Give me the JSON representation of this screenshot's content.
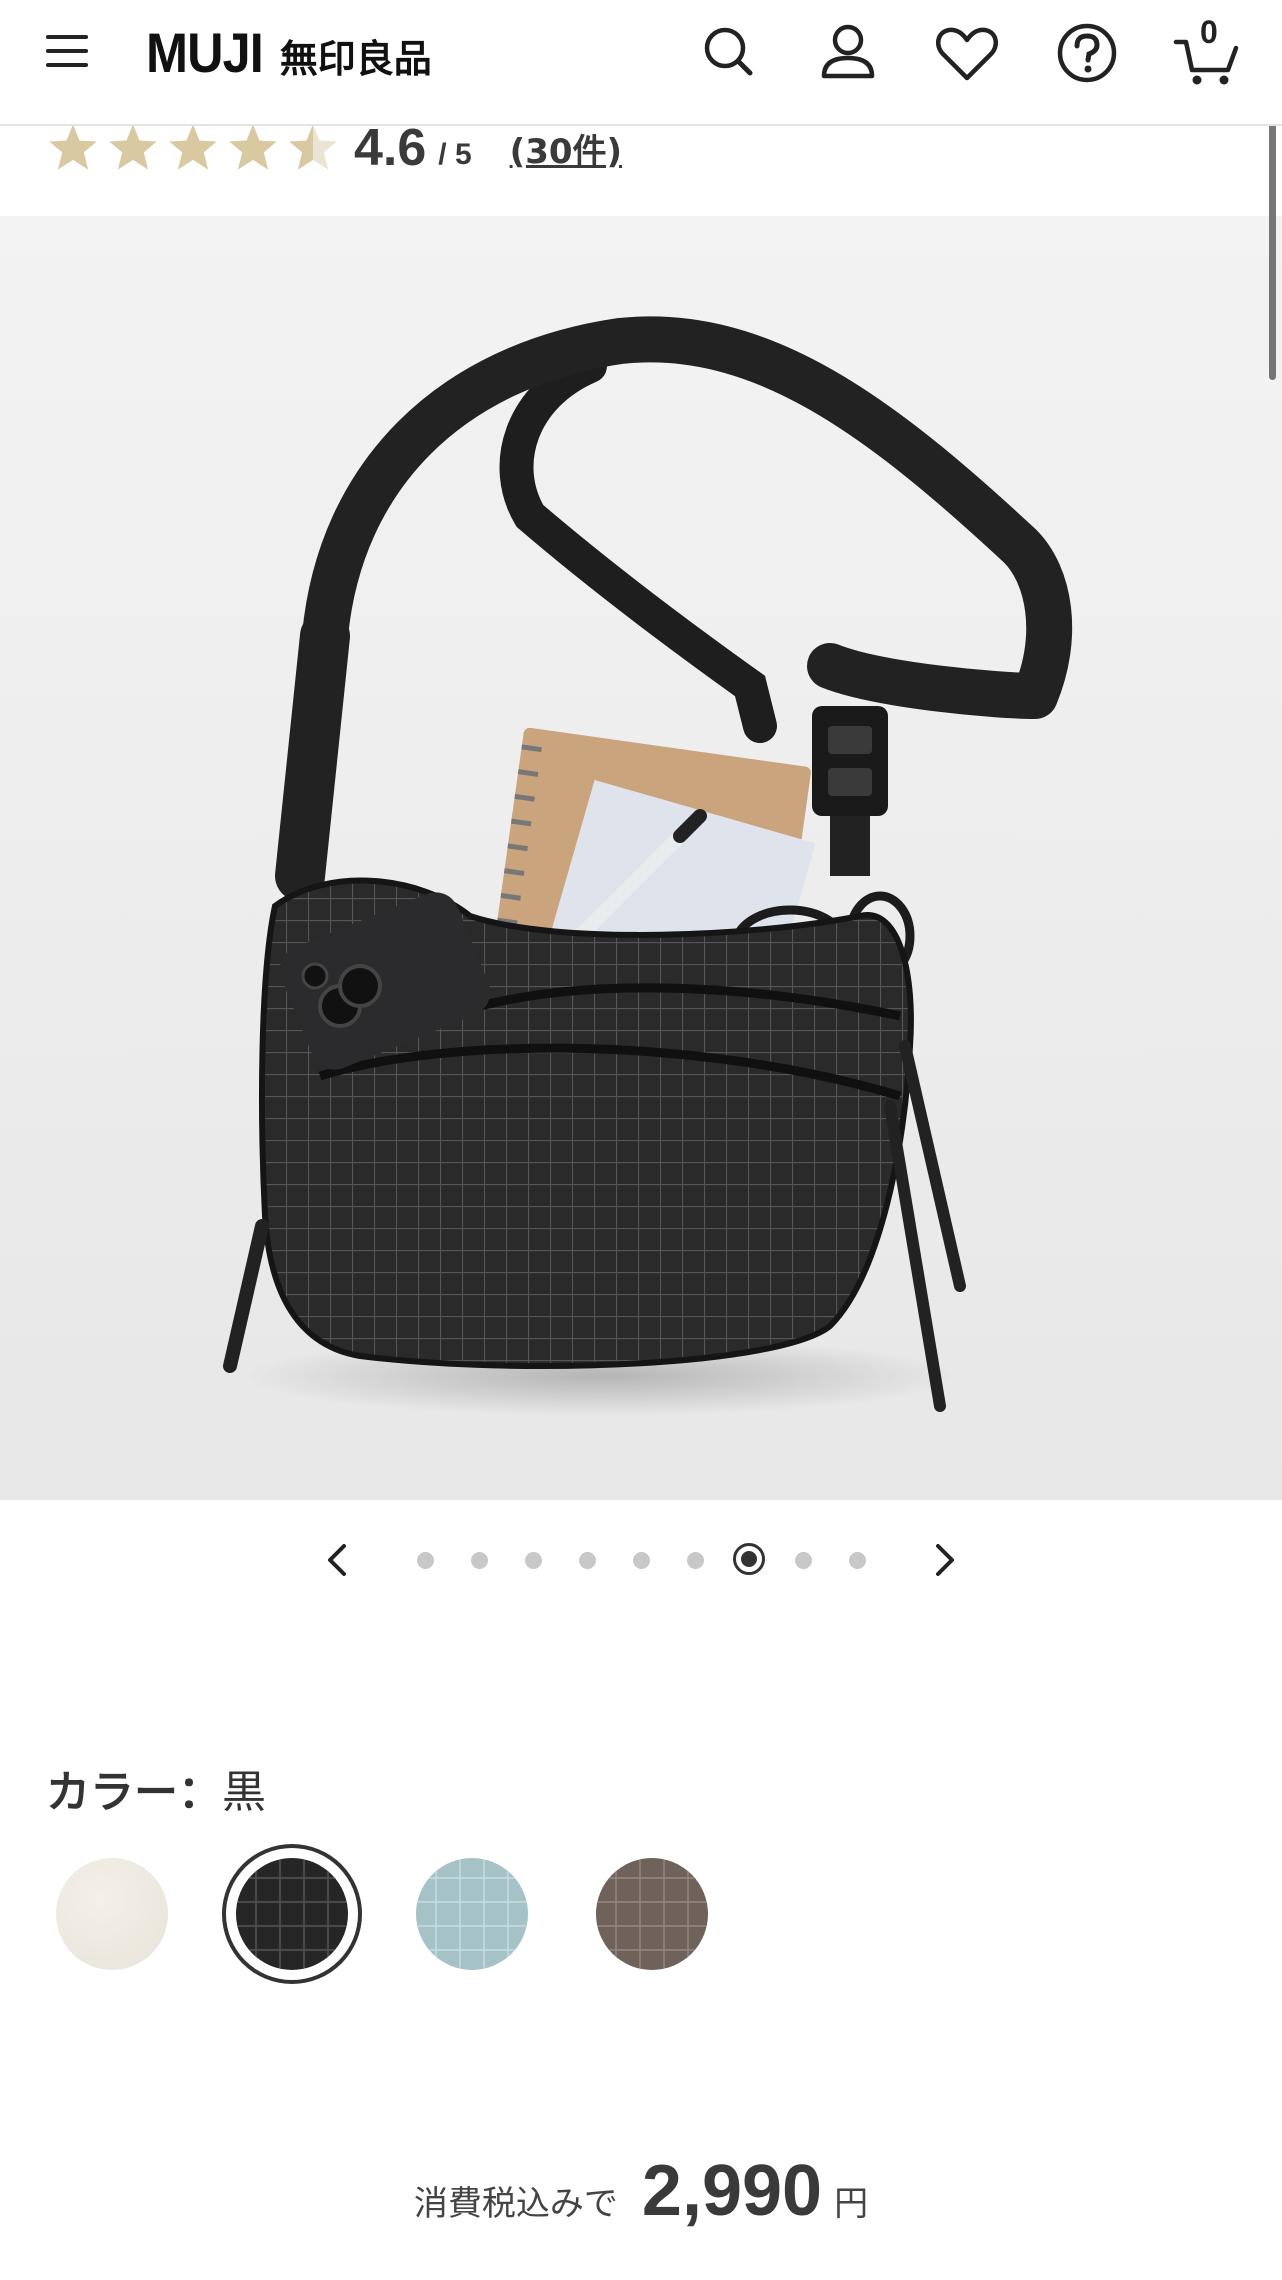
{
  "header": {
    "logo_en": "MUJI",
    "logo_jp": "無印良品",
    "cart_count": "0"
  },
  "rating": {
    "stars": 4.5,
    "value": "4.6",
    "max": "/ 5",
    "review_count": "(30件)"
  },
  "carousel": {
    "total": 9,
    "active_index": 6
  },
  "color": {
    "label": "カラー：",
    "selected_name": "黒",
    "swatches": [
      "off-white",
      "black",
      "light-blue",
      "brown"
    ]
  },
  "price": {
    "tax_label": "消費税込みで",
    "amount": "2,990",
    "currency": "円"
  },
  "colors": {
    "star": "#d9c9a0",
    "text": "#333333",
    "dot": "#c8c8c8"
  }
}
